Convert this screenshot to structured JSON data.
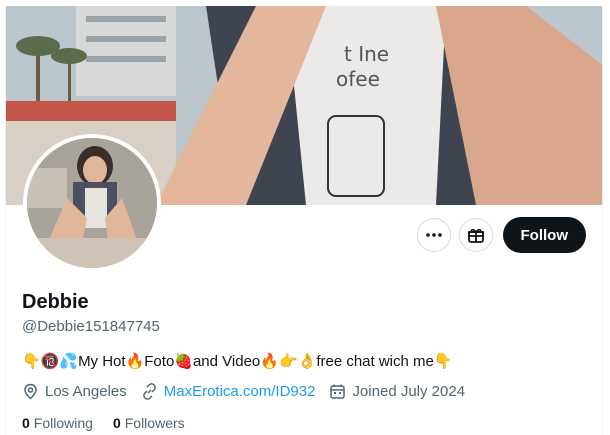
{
  "profile": {
    "name": "Debbie",
    "handle": "@Debbie151847745",
    "bio": {
      "e1": "👇",
      "e2": "🔞",
      "e3": "💦",
      "t1": "My Hot",
      "e4": "🔥",
      "t2": " Foto",
      "e5": "🍓",
      "t3": " and Video",
      "e6": "🔥",
      "e7": " 👉👌",
      "t4": " free chat wich me ",
      "e8": "👇"
    },
    "location": "Los Angeles",
    "website": "MaxErotica.com/ID932",
    "joined": "Joined July 2024",
    "following_count": "0",
    "following_label": "Following",
    "followers_count": "0",
    "followers_label": "Followers"
  },
  "actions": {
    "follow_label": "Follow",
    "more_icon": "more-icon",
    "gift_icon": "gift-icon"
  },
  "colors": {
    "text": "#0f1419",
    "secondary": "#536471",
    "link": "#1d9bf0",
    "follow_bg": "#0f1419"
  }
}
